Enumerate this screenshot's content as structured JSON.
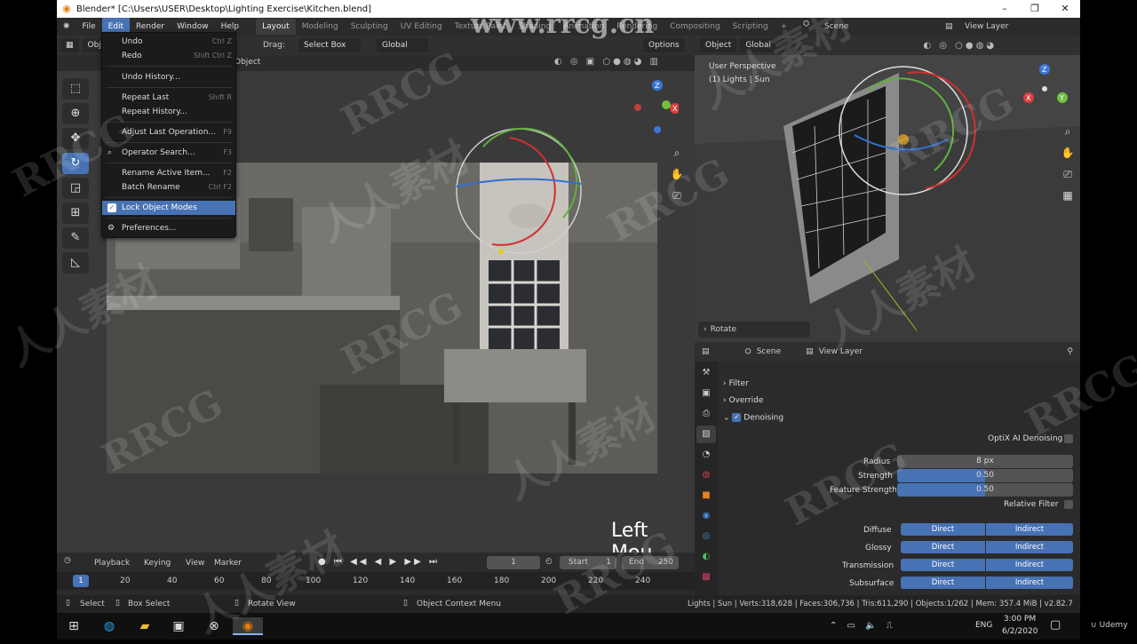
{
  "window": {
    "title": "Blender* [C:\\Users\\USER\\Desktop\\Lighting Exercise\\Kitchen.blend]",
    "controls": [
      "–",
      "❐",
      "✕"
    ]
  },
  "menubar": {
    "items": [
      "File",
      "Edit",
      "Render",
      "Window",
      "Help"
    ],
    "active": "Edit",
    "workspaces": [
      "Layout",
      "Modeling",
      "Sculpting",
      "UV Editing",
      "Texture Paint",
      "Shading",
      "Animation",
      "Rendering",
      "Compositing",
      "Scripting"
    ],
    "active_workspace": "Layout",
    "scene": "Scene",
    "view_layer": "View Layer"
  },
  "watermark_url": "www.rrcg.cn",
  "left_header": {
    "mode": "Object",
    "drag_label": "Drag:",
    "select_box": "Select Box",
    "orientation": "Global",
    "options": "Options",
    "object_label": "Object"
  },
  "edit_menu": {
    "items": [
      {
        "label": "Undo",
        "shortcut": "Ctrl Z"
      },
      {
        "label": "Redo",
        "shortcut": "Shift Ctrl Z"
      },
      {
        "label": "Undo History...",
        "shortcut": ""
      },
      {
        "label": "Repeat Last",
        "shortcut": "Shift R"
      },
      {
        "label": "Repeat History...",
        "shortcut": ""
      },
      {
        "label": "Adjust Last Operation...",
        "shortcut": "F9"
      },
      {
        "label": "Operator Search...",
        "shortcut": "F3"
      },
      {
        "label": "Rename Active Item...",
        "shortcut": "F2"
      },
      {
        "label": "Batch Rename",
        "shortcut": "Ctrl F2"
      },
      {
        "label": "Lock Object Modes",
        "shortcut": ""
      },
      {
        "label": "Preferences...",
        "shortcut": ""
      }
    ]
  },
  "caption": "Left Mou",
  "right_view": {
    "mode": "Object",
    "orientation": "Global",
    "perspective": "User Perspective",
    "selection": "(1) Lights | Sun",
    "last_op": "Rotate"
  },
  "properties": {
    "scene": "Scene",
    "view_layer": "View Layer",
    "sections": {
      "filter": "Filter",
      "override": "Override",
      "denoising": "Denoising"
    },
    "optix": "OptiX AI Denoising",
    "radius_label": "Radius",
    "radius_value": "8 px",
    "strength_label": "Strength",
    "strength_value": "0.50",
    "strength_fraction": 0.5,
    "feature_label": "Feature Strength",
    "feature_value": "0.50",
    "feature_fraction": 0.5,
    "relative_filter": "Relative Filter",
    "passes": [
      {
        "label": "Diffuse",
        "a": "Direct",
        "b": "Indirect"
      },
      {
        "label": "Glossy",
        "a": "Direct",
        "b": "Indirect"
      },
      {
        "label": "Transmission",
        "a": "Direct",
        "b": "Indirect"
      },
      {
        "label": "Subsurface",
        "a": "Direct",
        "b": "Indirect"
      }
    ]
  },
  "timeline": {
    "playback": "Playback",
    "keying": "Keying",
    "view": "View",
    "marker": "Marker",
    "current_frame": "1",
    "start_label": "Start",
    "start": "1",
    "end_label": "End",
    "end": "250",
    "ruler": [
      "1",
      "20",
      "40",
      "60",
      "80",
      "100",
      "120",
      "140",
      "160",
      "180",
      "200",
      "220",
      "240"
    ]
  },
  "statusbar": {
    "select": "Select",
    "box_select": "Box Select",
    "rotate_view": "Rotate View",
    "context_menu": "Object Context Menu",
    "stats": "Lights | Sun | Verts:318,628 | Faces:306,736 | Tris:611,290 | Objects:1/262 | Mem: 357.4 MiB | v2.82.7"
  },
  "taskbar": {
    "lang": "ENG",
    "time": "3:00 PM",
    "date": "6/2/2020",
    "udemy": "Udemy"
  },
  "colors": {
    "accent": "#4772b3",
    "background": "#1d1d1d"
  }
}
